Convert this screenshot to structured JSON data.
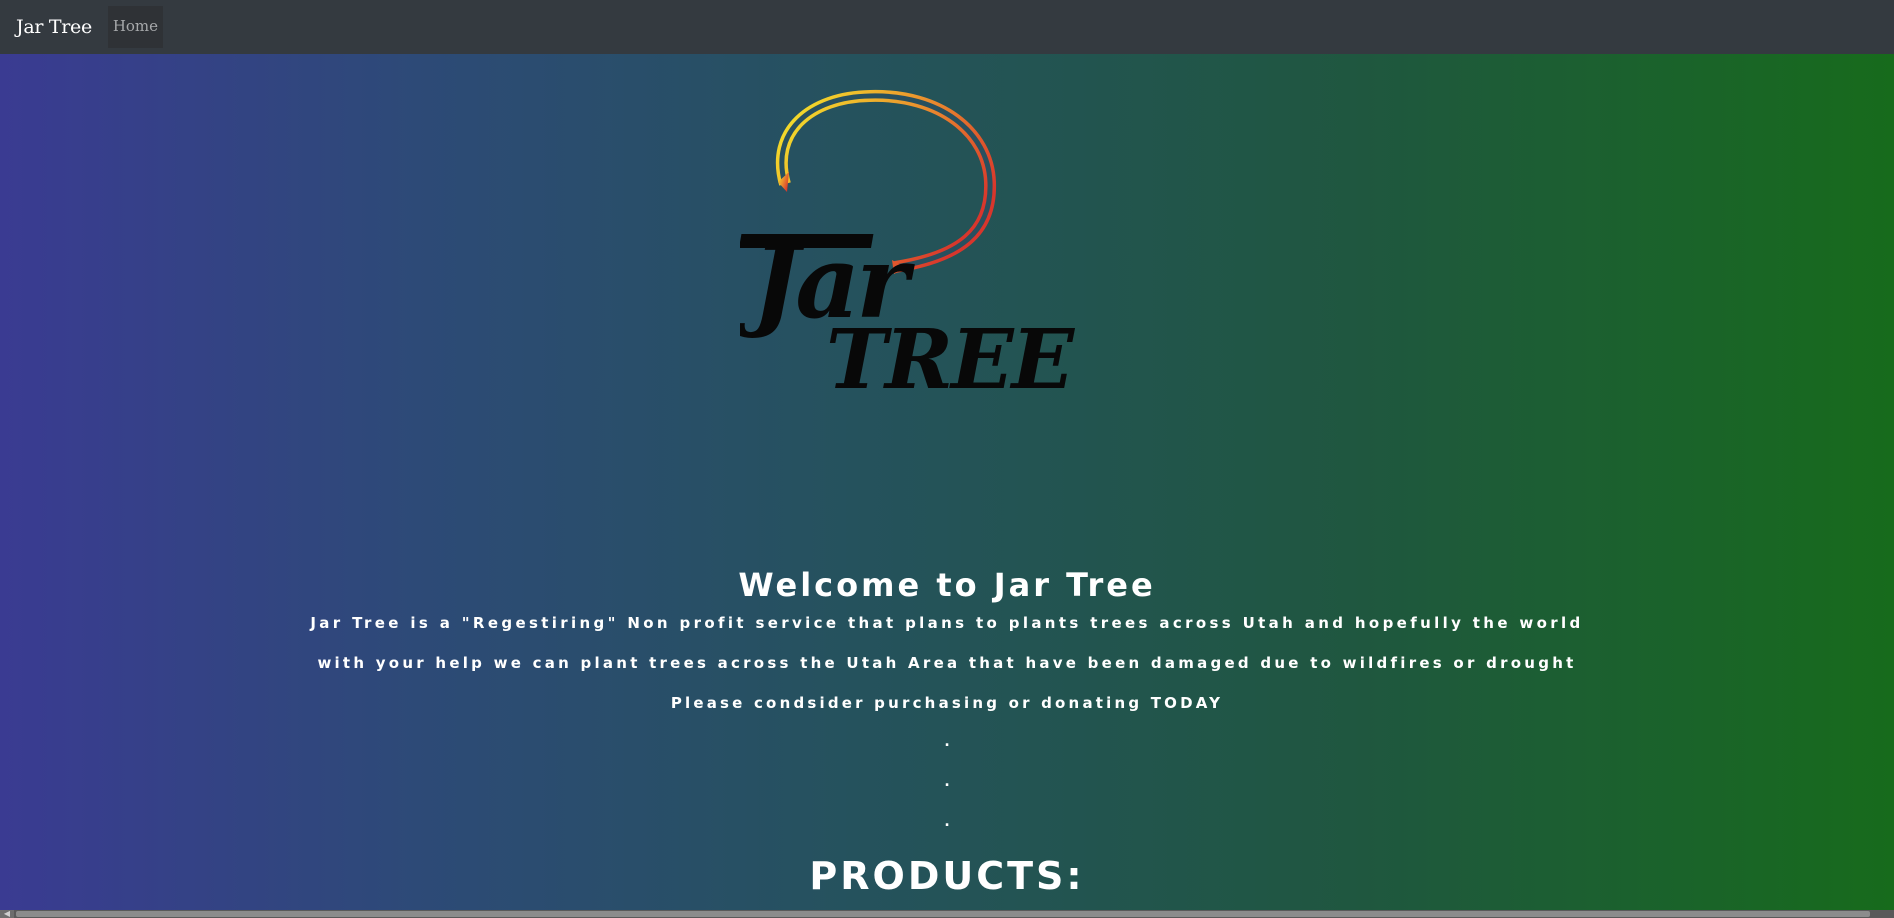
{
  "navbar": {
    "brand": "Jar Tree",
    "home_label": "Home"
  },
  "logo": {
    "word_top": "Jar",
    "word_bottom": "TREE"
  },
  "hero": {
    "welcome_title": "Welcome to Jar Tree",
    "line1": "Jar Tree is a \"Regestiring\" Non profit service that plans to plants trees across Utah and hopefully the world",
    "line2": "with your help we can plant trees across the Utah Area that have been damaged due to wildfires or drought",
    "line3": "Please condsider purchasing or donating TODAY",
    "dot": ".",
    "products_title": "PRODUCTS:"
  },
  "colors": {
    "navbar_bg": "#343a40",
    "gradient_left": "#3a3b92",
    "gradient_right": "#176b1c",
    "logo_arc_start": "#f5e52a",
    "logo_arc_end": "#d8362c"
  }
}
